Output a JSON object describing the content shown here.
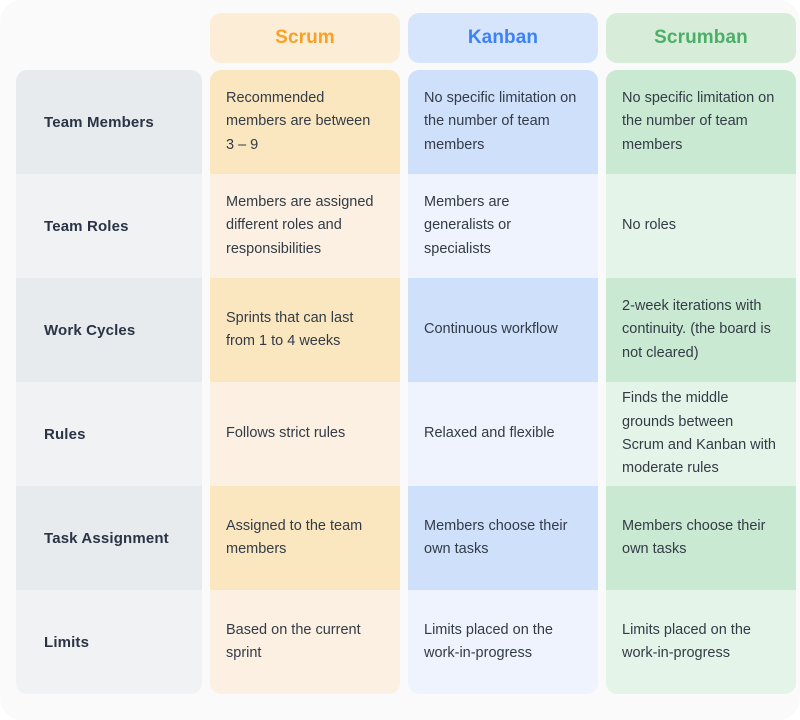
{
  "table": {
    "row_header_column_label": "",
    "columns": [
      {
        "id": "scrum",
        "label": "Scrum",
        "text_color": "#fba026",
        "header_bg": "#fceed6",
        "row_bg_odd": "#fae7c0",
        "row_bg_even": "#fbf0e2"
      },
      {
        "id": "kanban",
        "label": "Kanban",
        "text_color": "#3b82f6",
        "header_bg": "#d7e5fc",
        "row_bg_odd": "#cfe0fb",
        "row_bg_even": "#eef3fd"
      },
      {
        "id": "scrumban",
        "label": "Scrumban",
        "text_color": "#4caf68",
        "header_bg": "#d7edda",
        "row_bg_odd": "#cae9d2",
        "row_bg_even": "#e4f4e8"
      }
    ],
    "rows": [
      {
        "label": "Team Members",
        "scrum": "Recommended members are between 3 – 9",
        "kanban": "No specific limitation on the number of team members",
        "scrumban": "No specific limitation on the number of team members"
      },
      {
        "label": "Team Roles",
        "scrum": "Members are assigned different roles and responsibilities",
        "kanban": "Members are generalists or specialists",
        "scrumban": "No roles"
      },
      {
        "label": "Work Cycles",
        "scrum": "Sprints that can last from 1 to 4 weeks",
        "kanban": "Continuous workflow",
        "scrumban": "2-week iterations with continuity. (the board is not cleared)"
      },
      {
        "label": "Rules",
        "scrum": "Follows strict rules",
        "kanban": "Relaxed and flexible",
        "scrumban": "Finds the middle grounds between Scrum and Kanban with moderate rules"
      },
      {
        "label": "Task Assignment",
        "scrum": "Assigned to the team members",
        "kanban": "Members choose their own tasks",
        "scrumban": "Members choose their own tasks"
      },
      {
        "label": "Limits",
        "scrum": "Based on the current sprint",
        "kanban": "Limits placed on the work-in-progress",
        "scrumban": "Limits placed on the work-in-progress"
      }
    ]
  },
  "theme": {
    "page_bg": "#fafafa",
    "label_bg_odd": "#e7ebee",
    "label_bg_even": "#f1f2f4",
    "label_text": "#2b3445",
    "body_text": "#333b47"
  }
}
